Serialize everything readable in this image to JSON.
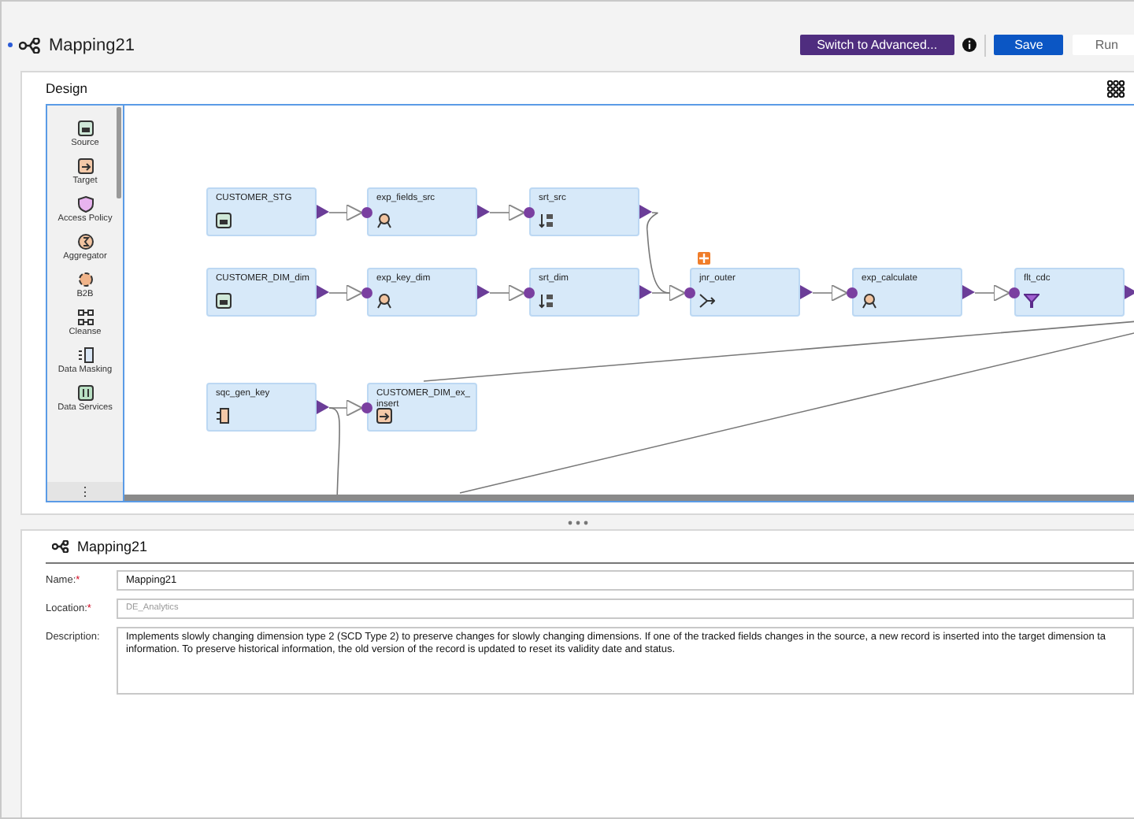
{
  "header": {
    "title": "Mapping21",
    "buttons": [
      {
        "label": "Switch to Advanced...",
        "kind": "advanced"
      },
      {
        "label": "Save",
        "kind": "primary"
      },
      {
        "label": "Run",
        "kind": "plain"
      }
    ]
  },
  "design": {
    "title": "Design",
    "palette": [
      {
        "label": "Source",
        "kind": "source"
      },
      {
        "label": "Target",
        "kind": "target"
      },
      {
        "label": "Access Policy",
        "kind": "policy"
      },
      {
        "label": "Aggregator",
        "kind": "aggregator"
      },
      {
        "label": "B2B",
        "kind": "b2b"
      },
      {
        "label": "Cleanse",
        "kind": "cleanse"
      },
      {
        "label": "Data Masking",
        "kind": "masking"
      },
      {
        "label": "Data Services",
        "kind": "services"
      }
    ],
    "more": "⋮",
    "nodes": [
      {
        "name": "CUSTOMER_STG",
        "kind": "source"
      },
      {
        "name": "exp_fields_src",
        "kind": "expression"
      },
      {
        "name": "srt_src",
        "kind": "sorter"
      },
      {
        "name": "CUSTOMER_DIM_dim",
        "kind": "source"
      },
      {
        "name": "exp_key_dim",
        "kind": "expression"
      },
      {
        "name": "srt_dim",
        "kind": "sorter"
      },
      {
        "name": "jnr_outer",
        "kind": "joiner"
      },
      {
        "name": "exp_calculate",
        "kind": "expression"
      },
      {
        "name": "flt_cdc",
        "kind": "filter"
      },
      {
        "name": "sqc_gen_key",
        "kind": "sequence"
      },
      {
        "name": "CUSTOMER_DIM_ex_insert",
        "kind": "target"
      }
    ]
  },
  "properties": {
    "title": "Mapping21",
    "fields": [
      {
        "label": "Name:",
        "required_mark": "*",
        "kind": "text",
        "value": "Mapping21"
      },
      {
        "label": "Location:",
        "required_mark": "*",
        "kind": "readonly",
        "value": "DE_Analytics"
      },
      {
        "label": "Description:",
        "kind": "textarea",
        "lines": [
          "Implements slowly changing dimension type 2 (SCD Type 2) to preserve changes for slowly changing dimensions. If one of the tracked fields changes in the source, a new record is inserted into the target dimension ta",
          "information. To preserve historical information, the old version of the record is updated to reset its validity date and status."
        ]
      }
    ]
  }
}
